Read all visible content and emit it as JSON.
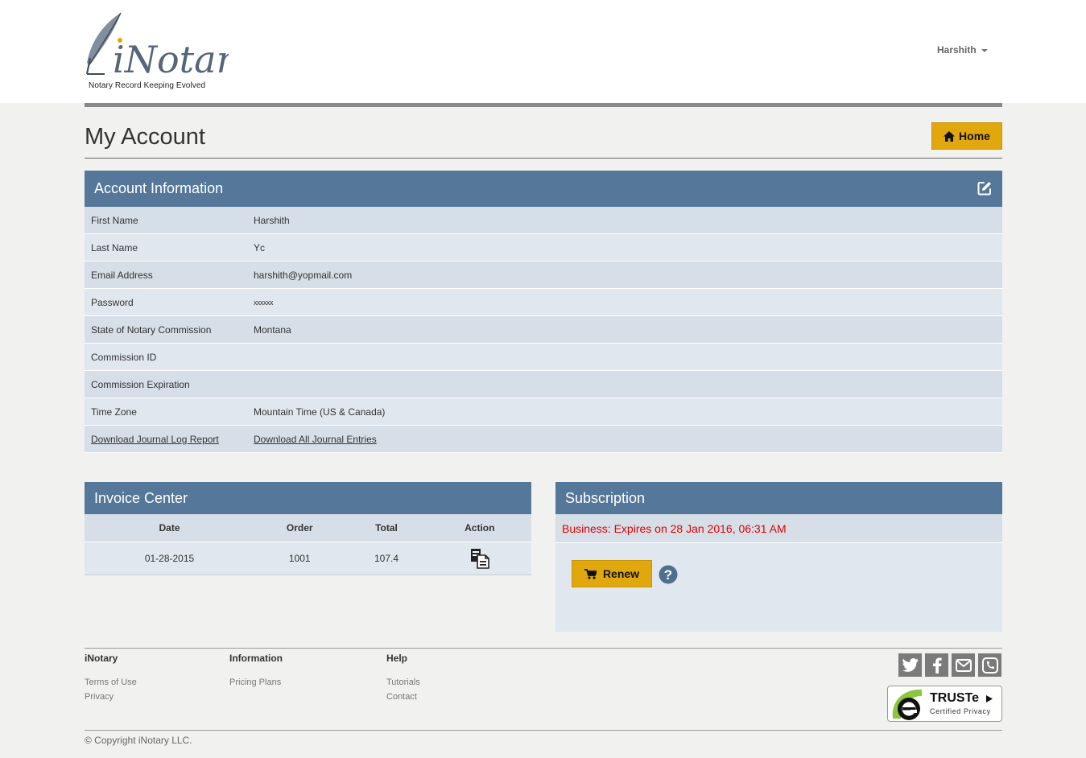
{
  "header": {
    "logo_text": "iNotary",
    "tagline": "Notary Record Keeping Evolved",
    "user_name": "Harshith"
  },
  "page": {
    "title": "My Account",
    "home_label": "Home"
  },
  "account": {
    "heading": "Account Information",
    "rows": [
      {
        "label": "First Name",
        "value": "Harshith"
      },
      {
        "label": "Last Name",
        "value": "Yc"
      },
      {
        "label": "Email Address",
        "value": "harshith@yopmail.com"
      },
      {
        "label": "Password",
        "value": "xxxxxx"
      },
      {
        "label": "State of Notary Commission",
        "value": "Montana"
      },
      {
        "label": "Commission ID",
        "value": ""
      },
      {
        "label": "Commission Expiration",
        "value": ""
      },
      {
        "label": "Time Zone",
        "value": "Mountain Time (US & Canada)"
      }
    ],
    "links": {
      "journal_log_report": "Download Journal Log Report",
      "all_journal_entries": "Download All Journal Entries"
    }
  },
  "invoice": {
    "heading": "Invoice Center",
    "columns": [
      "Date",
      "Order",
      "Total",
      "Action"
    ],
    "rows": [
      {
        "date": "01-28-2015",
        "order": "1001",
        "total": "107.4",
        "action_icon": "invoice-download-icon"
      }
    ]
  },
  "subscription": {
    "heading": "Subscription",
    "status": "Business: Expires on 28 Jan 2016, 06:31 AM",
    "status_color": "#e00000",
    "renew_label": "Renew"
  },
  "footer": {
    "columns": [
      {
        "title": "iNotary",
        "links": [
          "Terms of Use",
          "Privacy"
        ]
      },
      {
        "title": "Information",
        "links": [
          "Pricing Plans"
        ]
      },
      {
        "title": "Help",
        "links": [
          "Tutorials",
          "Contact"
        ]
      }
    ],
    "social_icons": [
      "twitter-icon",
      "facebook-icon",
      "email-icon",
      "phone-icon"
    ],
    "seal": {
      "title": "TRUSTe",
      "subtitle": "Certified Privacy"
    },
    "copyright": "© Copyright iNotary LLC."
  },
  "colors": {
    "panel_header": "#557799",
    "accent_button": "#e0a80d",
    "row_dark": "#d6dee7",
    "row_light": "#e1e7ee"
  }
}
